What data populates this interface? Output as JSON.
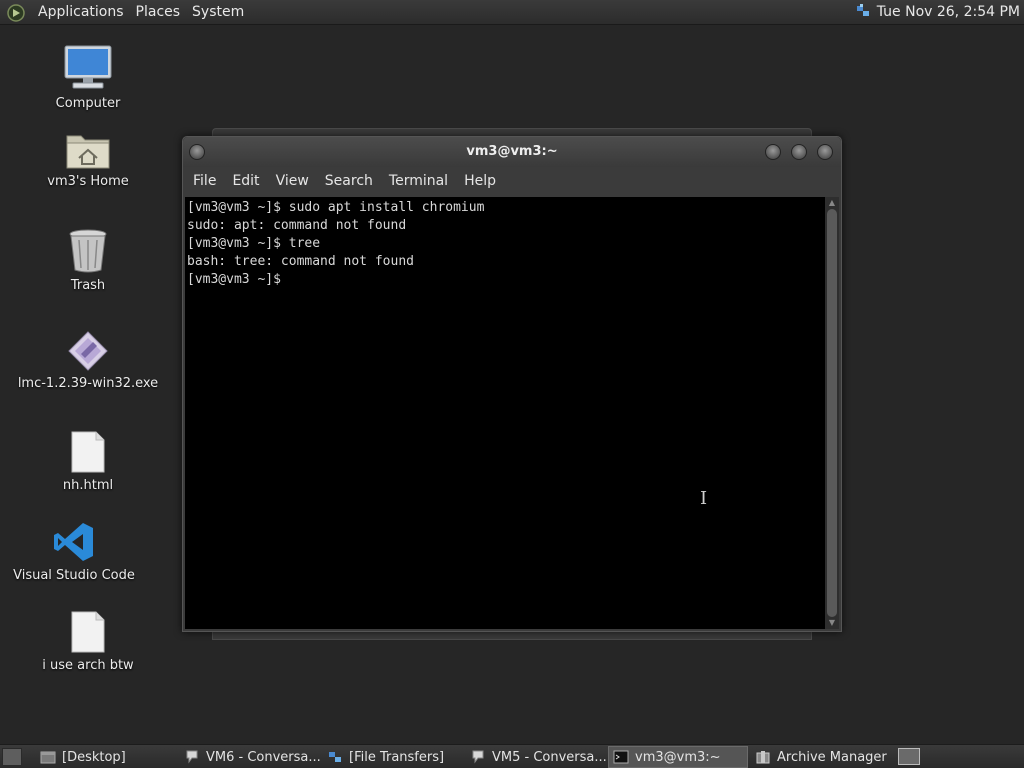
{
  "top_panel": {
    "menus": [
      "Applications",
      "Places",
      "System"
    ],
    "clock": "Tue Nov 26,  2:54 PM"
  },
  "desktop": {
    "icons": [
      {
        "label": "Computer",
        "icon": "computer-icon"
      },
      {
        "label": "vm3's Home",
        "icon": "home-folder-icon"
      },
      {
        "label": "Trash",
        "icon": "trash-icon"
      },
      {
        "label": "lmc-1.2.39-win32.exe",
        "icon": "executable-icon"
      },
      {
        "label": "nh.html",
        "icon": "file-icon"
      },
      {
        "label": "Visual Studio Code",
        "icon": "vscode-icon"
      },
      {
        "label": "i use arch btw",
        "icon": "file-icon"
      }
    ]
  },
  "terminal": {
    "title": "vm3@vm3:~",
    "menu": [
      "File",
      "Edit",
      "View",
      "Search",
      "Terminal",
      "Help"
    ],
    "lines": [
      "[vm3@vm3 ~]$ sudo apt install chromium",
      "sudo: apt: command not found",
      "[vm3@vm3 ~]$ tree",
      "bash: tree: command not found",
      "[vm3@vm3 ~]$ "
    ]
  },
  "taskbar": {
    "tasks": [
      {
        "label": "[Desktop]",
        "icon": "desktop-icon",
        "active": false
      },
      {
        "label": "VM6 - Conversa...",
        "icon": "chat-icon",
        "active": false
      },
      {
        "label": "[File Transfers]",
        "icon": "transfer-icon",
        "active": false
      },
      {
        "label": "VM5 - Conversa...",
        "icon": "chat-icon",
        "active": false
      },
      {
        "label": "vm3@vm3:~",
        "icon": "terminal-icon",
        "active": true
      },
      {
        "label": "Archive Manager",
        "icon": "archive-icon",
        "active": false
      }
    ]
  },
  "colors": {
    "desktop_bg": "#262626",
    "vscode_blue": "#2a8ad8",
    "terminal_bg": "#000000"
  }
}
